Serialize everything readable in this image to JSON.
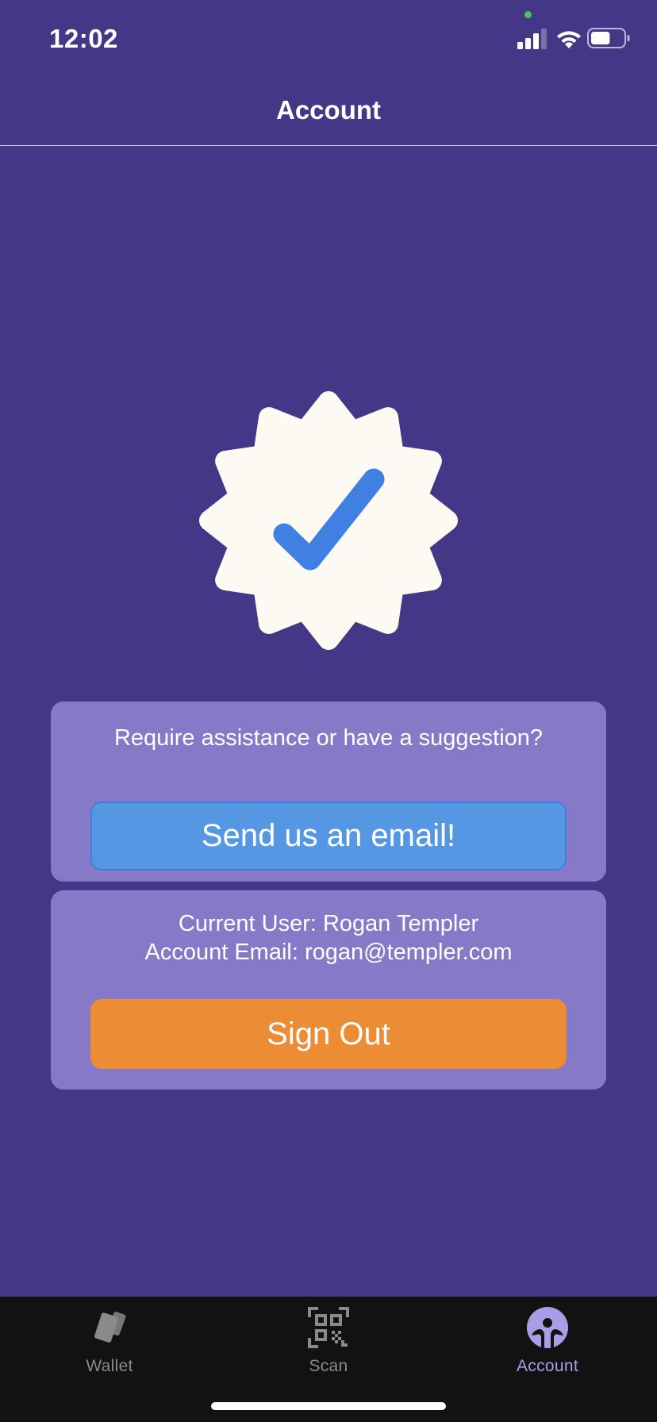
{
  "status_bar": {
    "time": "12:02",
    "battery_level": 0.6,
    "icons": [
      "signal-icon",
      "wifi-icon",
      "battery-icon"
    ]
  },
  "header": {
    "title": "Account"
  },
  "badge": {
    "icon": "verified-badge-icon",
    "badge_color": "#fcfaf3",
    "check_color": "#3f80e2"
  },
  "help_card": {
    "text": "Require assistance or have a suggestion?",
    "button_label": "Send us an email!"
  },
  "user_card": {
    "current_user": "Current User: Rogan Templer",
    "account_email": "Account Email: rogan@templer.com",
    "button_label": "Sign Out"
  },
  "tab_bar": {
    "tabs": [
      {
        "label": "Wallet",
        "icon": "wallet-cards-icon",
        "active": false
      },
      {
        "label": "Scan",
        "icon": "qr-code-icon",
        "active": false
      },
      {
        "label": "Account",
        "icon": "account-icon",
        "active": true
      }
    ]
  },
  "colors": {
    "background": "#453787",
    "card": "#8679c8",
    "email_button": "#5697e3",
    "signout_button": "#ec8c35",
    "tab_bar": "#121212",
    "active_tab": "#a99ee6",
    "inactive_tab": "#8a8a8a"
  }
}
